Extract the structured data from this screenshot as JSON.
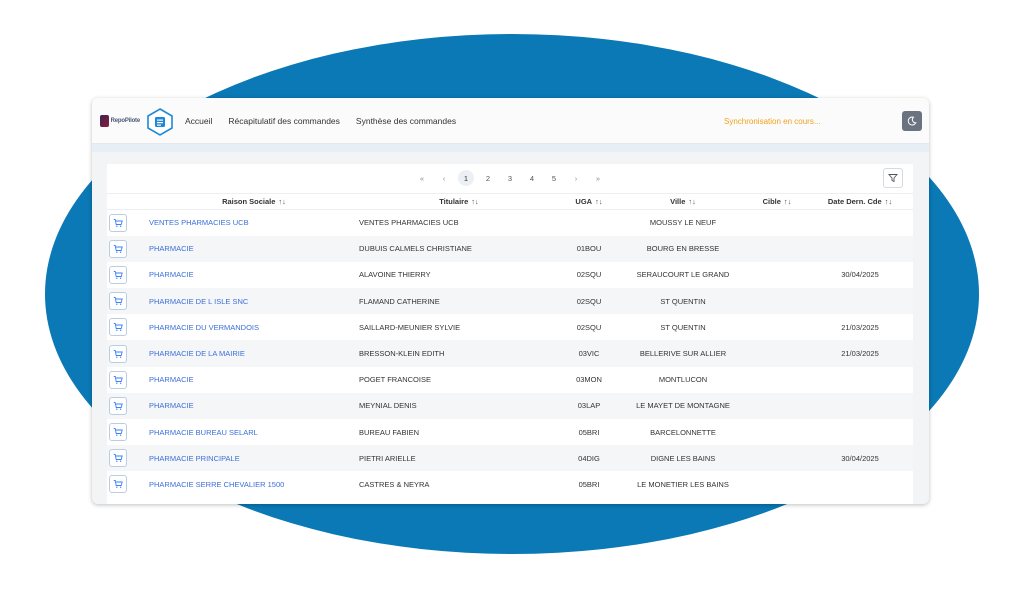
{
  "brand": {
    "logo_text": "RepoPilote",
    "accent": "#0a79b5"
  },
  "nav": {
    "items": [
      "Accueil",
      "Récapitulatif des commandes",
      "Synthèse des commandes"
    ]
  },
  "status": {
    "sync_text": "Synchronisation en cours..."
  },
  "pagination": {
    "first": "«",
    "prev": "‹",
    "pages": [
      "1",
      "2",
      "3",
      "4",
      "5"
    ],
    "active_page": "1",
    "next": "›",
    "last": "»"
  },
  "table": {
    "columns": [
      {
        "label": "Raison Sociale",
        "sort": "↑↓"
      },
      {
        "label": "Titulaire",
        "sort": "↑↓"
      },
      {
        "label": "UGA",
        "sort": "↑↓"
      },
      {
        "label": "Ville",
        "sort": "↑↓"
      },
      {
        "label": "Cible",
        "sort": "↑↓"
      },
      {
        "label": "Date Dern. Cde",
        "sort": "↑↓"
      }
    ],
    "rows": [
      {
        "raison": "VENTES PHARMACIES UCB",
        "titulaire": "VENTES PHARMACIES UCB",
        "uga": "",
        "ville": "MOUSSY LE NEUF",
        "cible": "",
        "date": ""
      },
      {
        "raison": "PHARMACIE",
        "titulaire": "DUBUIS CALMELS CHRISTIANE",
        "uga": "01BOU",
        "ville": "BOURG EN BRESSE",
        "cible": "",
        "date": ""
      },
      {
        "raison": "PHARMACIE",
        "titulaire": "ALAVOINE THIERRY",
        "uga": "02SQU",
        "ville": "SERAUCOURT LE GRAND",
        "cible": "",
        "date": "30/04/2025"
      },
      {
        "raison": "PHARMACIE DE L ISLE SNC",
        "titulaire": "FLAMAND CATHERINE",
        "uga": "02SQU",
        "ville": "ST QUENTIN",
        "cible": "",
        "date": ""
      },
      {
        "raison": "PHARMACIE DU VERMANDOIS",
        "titulaire": "SAILLARD-MEUNIER SYLVIE",
        "uga": "02SQU",
        "ville": "ST QUENTIN",
        "cible": "",
        "date": "21/03/2025"
      },
      {
        "raison": "PHARMACIE DE LA MAIRIE",
        "titulaire": "BRESSON-KLEIN EDITH",
        "uga": "03VIC",
        "ville": "BELLERIVE SUR ALLIER",
        "cible": "",
        "date": "21/03/2025"
      },
      {
        "raison": "PHARMACIE",
        "titulaire": "POGET FRANCOISE",
        "uga": "03MON",
        "ville": "MONTLUCON",
        "cible": "",
        "date": ""
      },
      {
        "raison": "PHARMACIE",
        "titulaire": "MEYNIAL DENIS",
        "uga": "03LAP",
        "ville": "LE MAYET DE MONTAGNE",
        "cible": "",
        "date": ""
      },
      {
        "raison": "PHARMACIE BUREAU SELARL",
        "titulaire": "BUREAU FABIEN",
        "uga": "05BRI",
        "ville": "BARCELONNETTE",
        "cible": "",
        "date": ""
      },
      {
        "raison": "PHARMACIE PRINCIPALE",
        "titulaire": "PIETRI ARIELLE",
        "uga": "04DIG",
        "ville": "DIGNE LES BAINS",
        "cible": "",
        "date": "30/04/2025"
      },
      {
        "raison": "PHARMACIE SERRE CHEVALIER 1500",
        "titulaire": "CASTRES & NEYRA",
        "uga": "05BRI",
        "ville": "LE MONETIER LES BAINS",
        "cible": "",
        "date": ""
      }
    ]
  },
  "icons": {
    "cart": "cart-icon",
    "filter": "filter-icon",
    "theme": "moon-icon",
    "app": "app-badge-icon"
  }
}
